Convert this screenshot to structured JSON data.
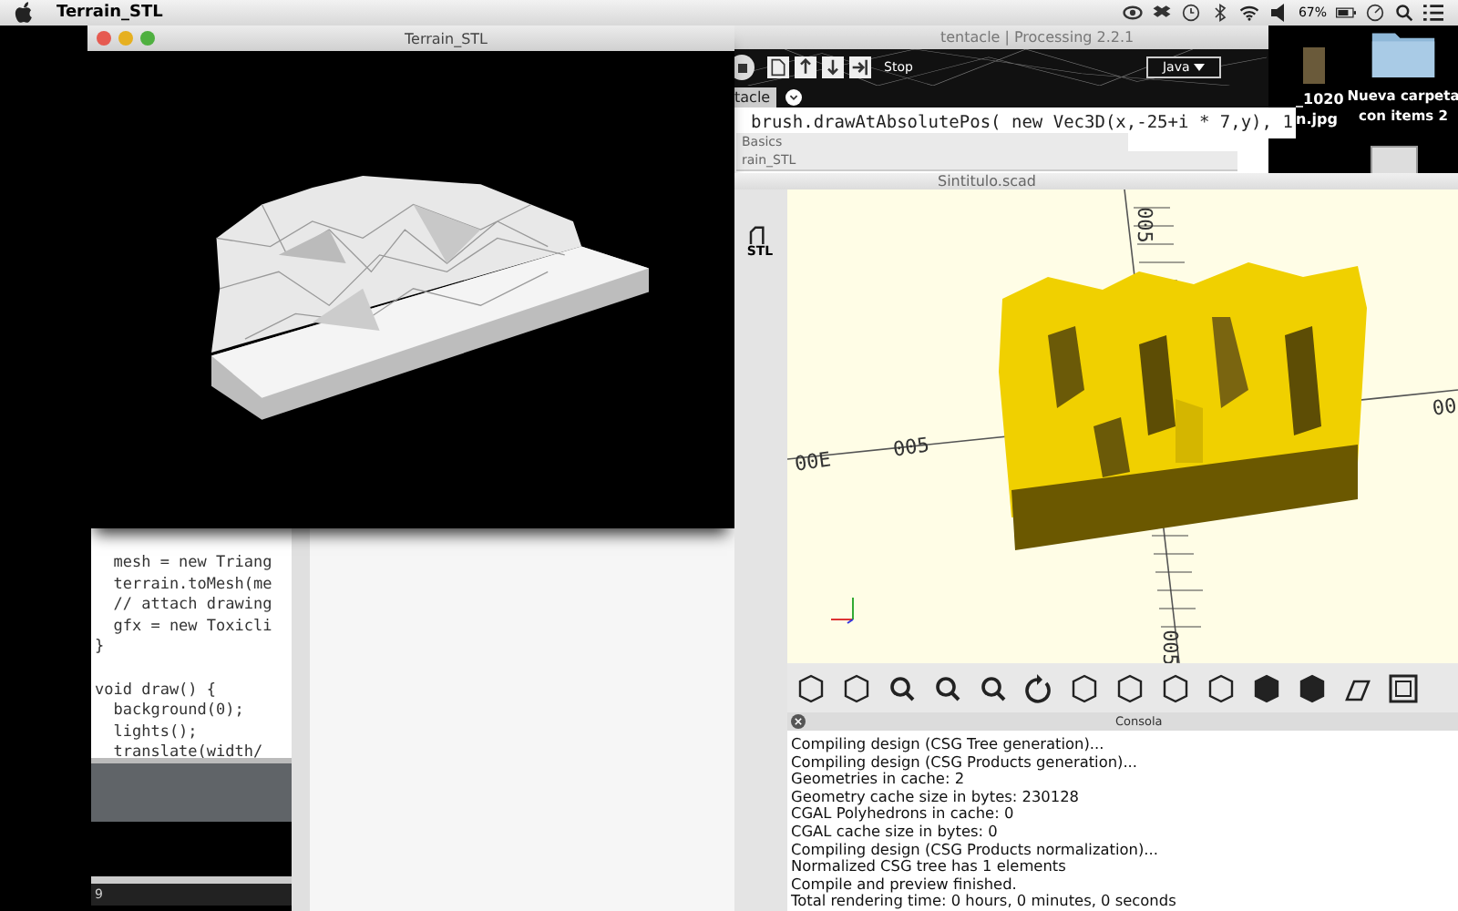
{
  "menu_bar": {
    "app_name": "Terrain_STL",
    "battery": "67%"
  },
  "desktop_icons": [
    {
      "kind": "image",
      "label_lines": [
        "_1020",
        "n.jpg"
      ]
    },
    {
      "kind": "folder",
      "label_lines": [
        "Nueva carpeta",
        "con items 2"
      ]
    }
  ],
  "processing": {
    "title": "tentacle | Processing 2.2.1",
    "run_status": "Stop",
    "mode": "Java",
    "tab": "tacle",
    "code_line": "brush.drawAtAbsolutePos( new Vec3D(x,-25+i * 7,y), 1",
    "subwindows": [
      "Basics",
      "rain_STL"
    ],
    "code_blocks": [
      [
        "  mesh = new Triang",
        "  terrain.toMesh(me",
        "  // attach drawing",
        "  gfx = new Toxicli",
        "}"
      ],
      [
        "void draw() {",
        "  background(0);",
        "  lights();",
        "  translate(width/"
      ]
    ],
    "console_line": "9"
  },
  "terrain_window": {
    "title": "Terrain_STL"
  },
  "openscad": {
    "title": "Sintitulo.scad",
    "stl_button": "STL",
    "axis_labels": [
      "005",
      "005",
      "00",
      "00E",
      "005"
    ],
    "console_title": "Consola",
    "console_lines": [
      "Compiling design (CSG Tree generation)...",
      "Compiling design (CSG Products generation)...",
      "Geometries in cache: 2",
      "Geometry cache size in bytes: 230128",
      "CGAL Polyhedrons in cache: 0",
      "CGAL cache size in bytes: 0",
      "Compiling design (CSG Products normalization)...",
      "Normalized CSG tree has 1 elements",
      "Compile and preview finished.",
      "Total rendering time: 0 hours, 0 minutes, 0 seconds"
    ]
  }
}
